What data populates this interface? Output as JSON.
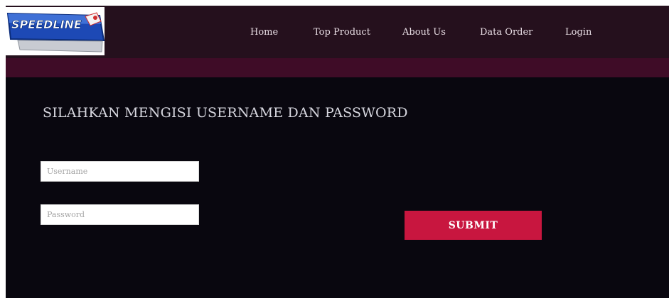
{
  "header": {
    "logo_text": "SPEEDLINE",
    "nav": [
      {
        "label": "Home"
      },
      {
        "label": "Top Product"
      },
      {
        "label": "About Us"
      },
      {
        "label": "Data Order"
      },
      {
        "label": "Login"
      }
    ]
  },
  "main": {
    "title": "SILAHKAN MENGISI USERNAME DAN PASSWORD",
    "username": {
      "placeholder": "Username",
      "value": ""
    },
    "password": {
      "placeholder": "Password",
      "value": ""
    },
    "submit_label": "SUBMIT"
  },
  "colors": {
    "header_bg": "#25101d",
    "accent_bar": "#3f0c27",
    "content_bg": "#09070f",
    "submit_bg": "#c8163f"
  }
}
